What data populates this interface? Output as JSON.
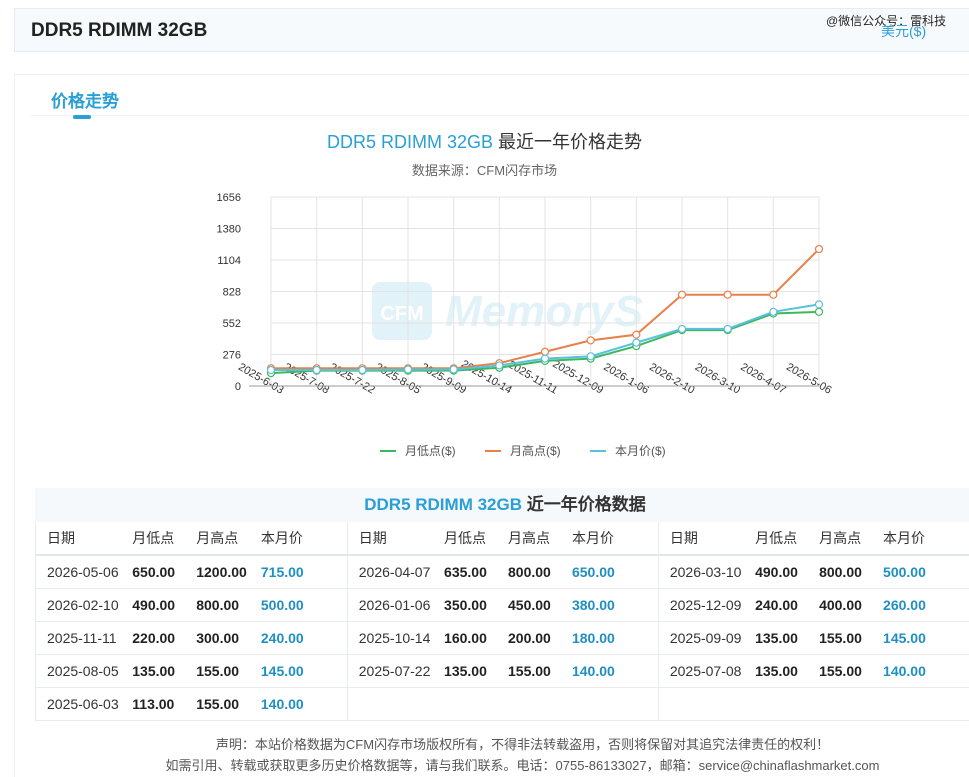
{
  "header": {
    "title": "DDR5 RDIMM 32GB",
    "currency_link": "美元($)"
  },
  "watermark": "@微信公众号：雷科技",
  "tabs": {
    "active_label": "价格走势"
  },
  "chart_title": {
    "product": "DDR5 RDIMM 32GB",
    "suffix": " 最近一年价格走势"
  },
  "chart_subtitle": "数据来源：CFM闪存市场",
  "chart_watermark": "CFM MemoryS",
  "chart_data": {
    "type": "line",
    "title": "DDR5 RDIMM 32GB 最近一年价格走势",
    "subtitle": "数据来源：CFM闪存市场",
    "categories": [
      "2025-6-03",
      "2025-7-08",
      "2025-7-22",
      "2025-8-05",
      "2025-9-09",
      "2025-10-14",
      "2025-11-11",
      "2025-12-09",
      "2026-1-06",
      "2026-2-10",
      "2026-3-10",
      "2026-4-07",
      "2026-5-06"
    ],
    "yticks": [
      0,
      276,
      552,
      828,
      1104,
      1380,
      1656
    ],
    "ylim": [
      0,
      1656
    ],
    "grid": true,
    "legend_position": "bottom",
    "series": [
      {
        "name": "月低点($)",
        "color": "#3cb85c",
        "values": [
          113,
          135,
          135,
          135,
          135,
          160,
          220,
          240,
          350,
          490,
          490,
          635,
          650
        ]
      },
      {
        "name": "月高点($)",
        "color": "#e8804a",
        "values": [
          155,
          155,
          155,
          155,
          155,
          200,
          300,
          400,
          450,
          800,
          800,
          800,
          1200
        ]
      },
      {
        "name": "本月价($)",
        "color": "#5bc0de",
        "values": [
          140,
          140,
          140,
          145,
          145,
          180,
          240,
          260,
          380,
          500,
          500,
          650,
          715
        ]
      }
    ]
  },
  "table": {
    "title_product": "DDR5 RDIMM 32GB",
    "title_suffix": " 近一年价格数据",
    "headers": {
      "date": "日期",
      "low": "月低点",
      "high": "月高点",
      "avg": "本月价"
    },
    "rows": [
      [
        {
          "date": "2026-05-06",
          "low": "650.00",
          "high": "1200.00",
          "avg": "715.00"
        },
        {
          "date": "2026-04-07",
          "low": "635.00",
          "high": "800.00",
          "avg": "650.00"
        },
        {
          "date": "2026-03-10",
          "low": "490.00",
          "high": "800.00",
          "avg": "500.00"
        }
      ],
      [
        {
          "date": "2026-02-10",
          "low": "490.00",
          "high": "800.00",
          "avg": "500.00"
        },
        {
          "date": "2026-01-06",
          "low": "350.00",
          "high": "450.00",
          "avg": "380.00"
        },
        {
          "date": "2025-12-09",
          "low": "240.00",
          "high": "400.00",
          "avg": "260.00"
        }
      ],
      [
        {
          "date": "2025-11-11",
          "low": "220.00",
          "high": "300.00",
          "avg": "240.00"
        },
        {
          "date": "2025-10-14",
          "low": "160.00",
          "high": "200.00",
          "avg": "180.00"
        },
        {
          "date": "2025-09-09",
          "low": "135.00",
          "high": "155.00",
          "avg": "145.00"
        }
      ],
      [
        {
          "date": "2025-08-05",
          "low": "135.00",
          "high": "155.00",
          "avg": "145.00"
        },
        {
          "date": "2025-07-22",
          "low": "135.00",
          "high": "155.00",
          "avg": "140.00"
        },
        {
          "date": "2025-07-08",
          "low": "135.00",
          "high": "155.00",
          "avg": "140.00"
        }
      ],
      [
        {
          "date": "2025-06-03",
          "low": "113.00",
          "high": "155.00",
          "avg": "140.00"
        }
      ]
    ]
  },
  "footer": {
    "line1": "声明：本站价格数据为CFM闪存市场版权所有，不得非法转载盗用，否则将保留对其追究法律责任的权利！",
    "line2": "如需引用、转载或获取更多历史价格数据等，请与我们联系。电话：0755-86133027，邮箱：service@chinaflashmarket.com"
  }
}
